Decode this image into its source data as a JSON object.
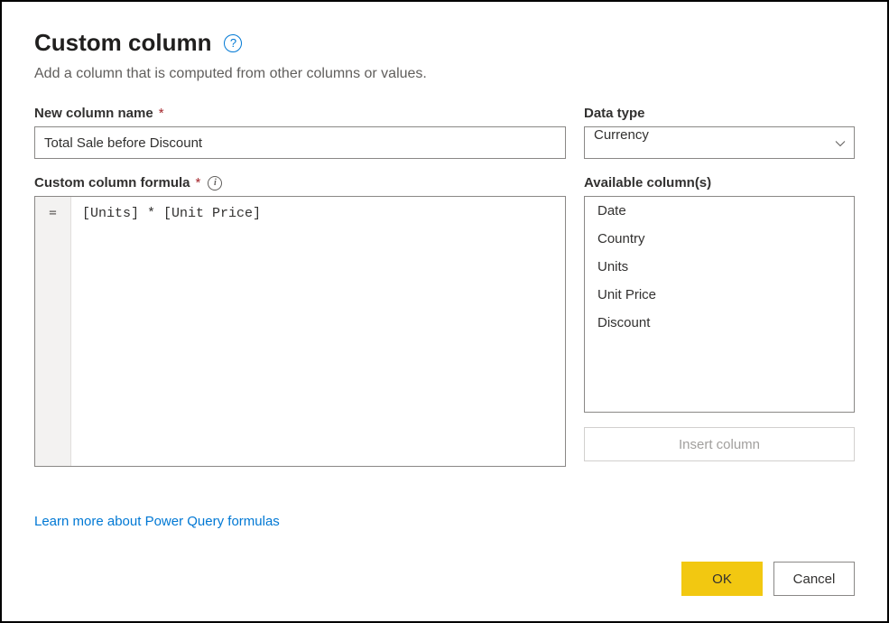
{
  "dialog": {
    "title": "Custom column",
    "subtitle": "Add a column that is computed from other columns or values."
  },
  "newColumn": {
    "label": "New column name",
    "value": "Total Sale before Discount"
  },
  "dataType": {
    "label": "Data type",
    "value": "Currency"
  },
  "formula": {
    "label": "Custom column formula",
    "gutter": "=",
    "value": "[Units] * [Unit Price]"
  },
  "availableColumns": {
    "label": "Available column(s)",
    "items": [
      "Date",
      "Country",
      "Units",
      "Unit Price",
      "Discount"
    ]
  },
  "insertButton": "Insert column",
  "learnLink": "Learn more about Power Query formulas",
  "buttons": {
    "ok": "OK",
    "cancel": "Cancel"
  },
  "requiredMark": "*"
}
